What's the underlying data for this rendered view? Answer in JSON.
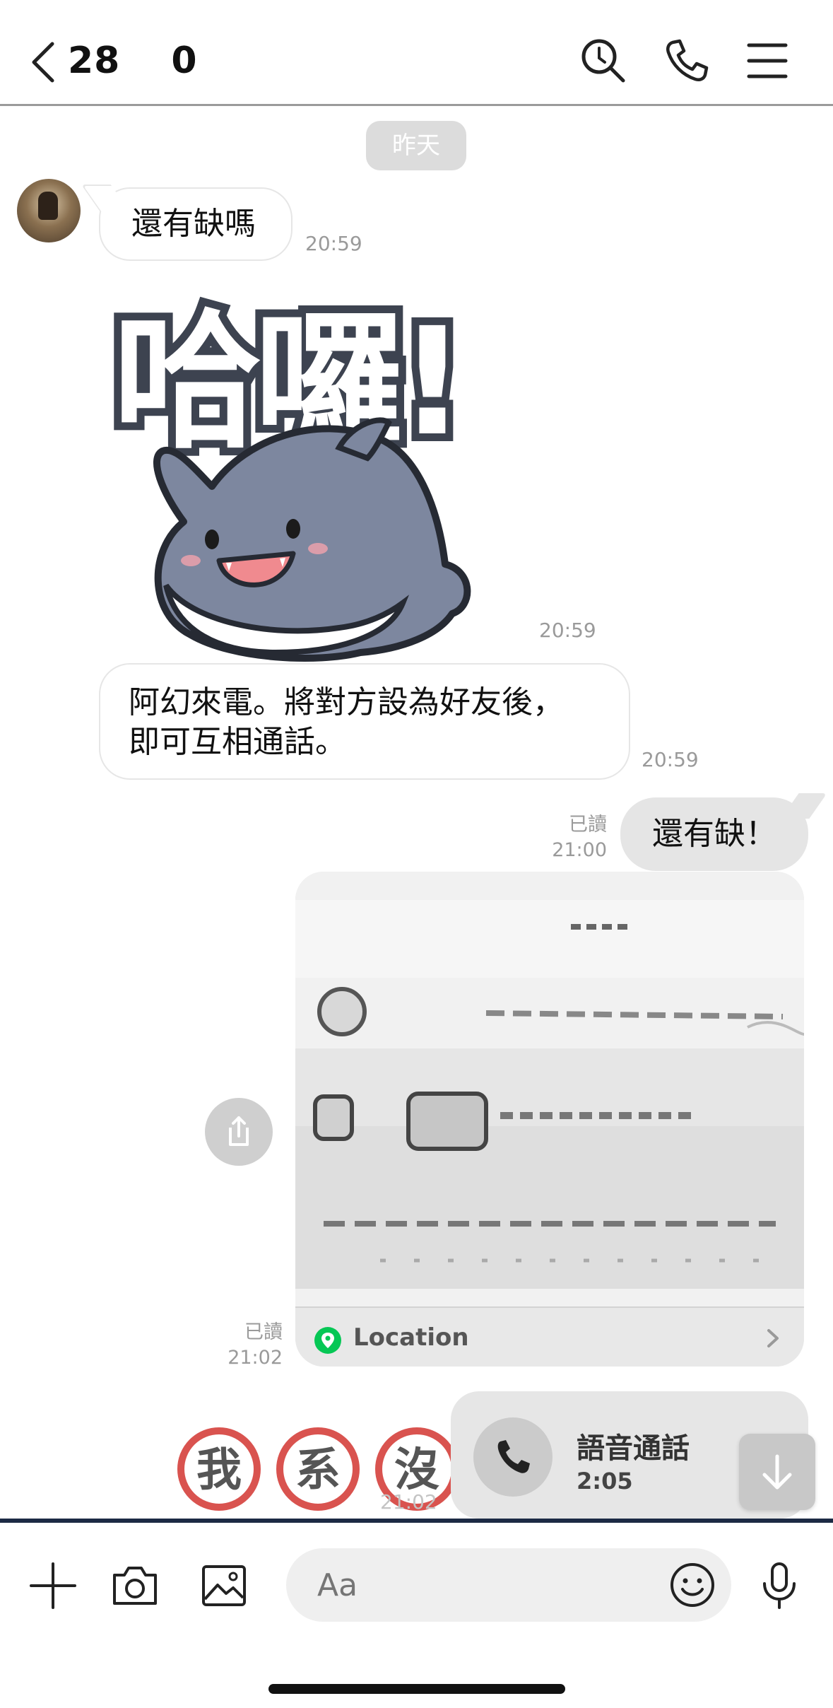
{
  "header": {
    "title_part1": "28",
    "title_part2": "0"
  },
  "chat": {
    "date_separator": "昨天",
    "messages": [
      {
        "text": "還有缺嗎",
        "time": "20:59"
      },
      {
        "sticker_text": "哈囉!",
        "time": "20:59"
      },
      {
        "text_line1": "阿幻來電。將對方設為好友後，",
        "text_line2": "即可互相通話。",
        "time": "20:59"
      },
      {
        "text": "還有缺！",
        "read": "已讀",
        "time": "21:00"
      },
      {
        "location_label": "Location",
        "read": "已讀",
        "time": "21:02"
      },
      {
        "stamp_chars": [
          "我",
          "系",
          "沒"
        ],
        "time": "21:02"
      }
    ],
    "call_popup": {
      "title": "語音通話",
      "duration": "2:05"
    }
  },
  "input_bar": {
    "placeholder": "Aa"
  },
  "colors": {
    "header_border": "#9a9a9a",
    "outgoing_bubble": "#e5e5e5",
    "incoming_border": "#e6e6e6",
    "input_top_border": "#1c2a44",
    "location_pin": "#06c755",
    "stamp_red": "#d9534f"
  },
  "icons": [
    "back-icon",
    "search-icon",
    "phone-icon",
    "menu-icon",
    "share-icon",
    "pin-icon",
    "chevron-right-icon",
    "arrow-down-icon",
    "plus-icon",
    "camera-icon",
    "image-icon",
    "emoji-icon",
    "mic-icon"
  ]
}
